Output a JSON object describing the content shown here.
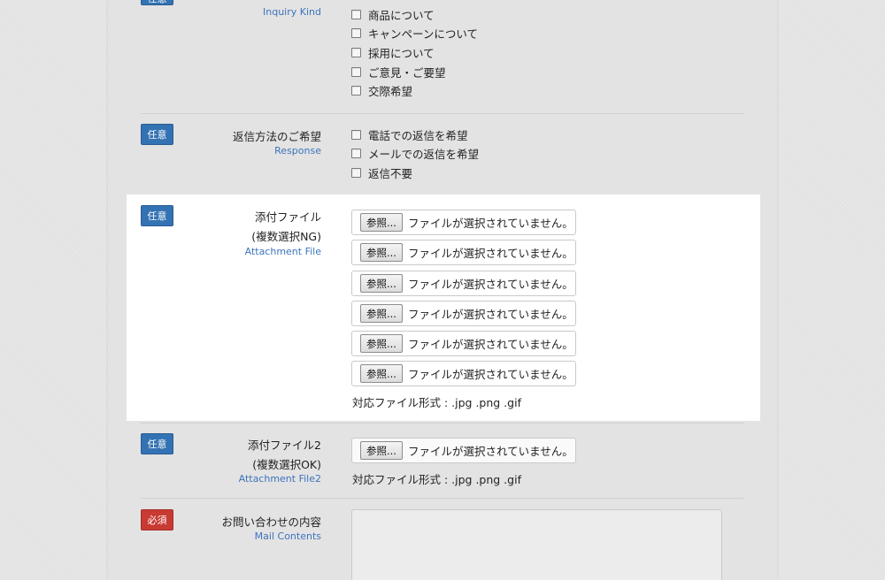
{
  "inquiry_kind": {
    "badge": "任意",
    "label_en": "Inquiry Kind",
    "options": [
      "商品について",
      "キャンペーンについて",
      "採用について",
      "ご意見・ご要望",
      "交際希望"
    ]
  },
  "response": {
    "badge": "任意",
    "label_jp": "返信方法のご希望",
    "label_en": "Response",
    "options": [
      "電話での返信を希望",
      "メールでの返信を希望",
      "返信不要"
    ]
  },
  "attachment": {
    "badge": "任意",
    "label_jp": "添付ファイル",
    "label_jp2": "(複数選択NG)",
    "label_en": "Attachment File",
    "browse_label": "参照...",
    "no_file": "ファイルが選択されていません。",
    "format_note": "対応ファイル形式 : .jpg .png .gif"
  },
  "attachment2": {
    "badge": "任意",
    "label_jp": "添付ファイル2",
    "label_jp2": "(複数選択OK)",
    "label_en": "Attachment File2",
    "browse_label": "参照...",
    "no_file": "ファイルが選択されていません。",
    "format_note": "対応ファイル形式 : .jpg .png .gif"
  },
  "mail_contents": {
    "badge": "必須",
    "label_jp": "お問い合わせの内容",
    "label_en": "Mail Contents"
  },
  "colors": {
    "optional_badge": "#3372b3",
    "required_badge": "#c83a32",
    "english_label": "#3d74bd"
  }
}
